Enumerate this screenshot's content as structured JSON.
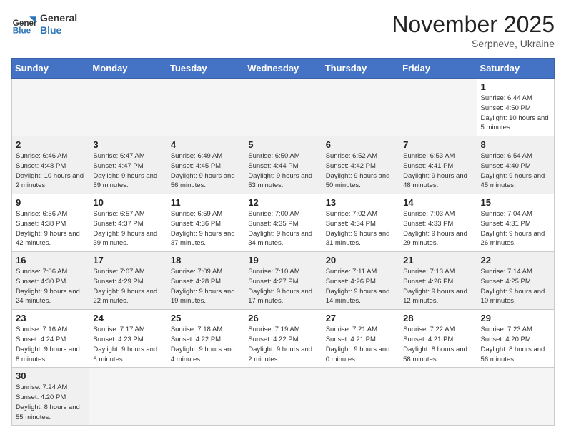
{
  "header": {
    "logo_general": "General",
    "logo_blue": "Blue",
    "month_title": "November 2025",
    "subtitle": "Serpneve, Ukraine"
  },
  "days_of_week": [
    "Sunday",
    "Monday",
    "Tuesday",
    "Wednesday",
    "Thursday",
    "Friday",
    "Saturday"
  ],
  "weeks": [
    [
      {
        "day": "",
        "info": ""
      },
      {
        "day": "",
        "info": ""
      },
      {
        "day": "",
        "info": ""
      },
      {
        "day": "",
        "info": ""
      },
      {
        "day": "",
        "info": ""
      },
      {
        "day": "",
        "info": ""
      },
      {
        "day": "1",
        "info": "Sunrise: 6:44 AM\nSunset: 4:50 PM\nDaylight: 10 hours and 5 minutes."
      }
    ],
    [
      {
        "day": "2",
        "info": "Sunrise: 6:46 AM\nSunset: 4:48 PM\nDaylight: 10 hours and 2 minutes."
      },
      {
        "day": "3",
        "info": "Sunrise: 6:47 AM\nSunset: 4:47 PM\nDaylight: 9 hours and 59 minutes."
      },
      {
        "day": "4",
        "info": "Sunrise: 6:49 AM\nSunset: 4:45 PM\nDaylight: 9 hours and 56 minutes."
      },
      {
        "day": "5",
        "info": "Sunrise: 6:50 AM\nSunset: 4:44 PM\nDaylight: 9 hours and 53 minutes."
      },
      {
        "day": "6",
        "info": "Sunrise: 6:52 AM\nSunset: 4:42 PM\nDaylight: 9 hours and 50 minutes."
      },
      {
        "day": "7",
        "info": "Sunrise: 6:53 AM\nSunset: 4:41 PM\nDaylight: 9 hours and 48 minutes."
      },
      {
        "day": "8",
        "info": "Sunrise: 6:54 AM\nSunset: 4:40 PM\nDaylight: 9 hours and 45 minutes."
      }
    ],
    [
      {
        "day": "9",
        "info": "Sunrise: 6:56 AM\nSunset: 4:38 PM\nDaylight: 9 hours and 42 minutes."
      },
      {
        "day": "10",
        "info": "Sunrise: 6:57 AM\nSunset: 4:37 PM\nDaylight: 9 hours and 39 minutes."
      },
      {
        "day": "11",
        "info": "Sunrise: 6:59 AM\nSunset: 4:36 PM\nDaylight: 9 hours and 37 minutes."
      },
      {
        "day": "12",
        "info": "Sunrise: 7:00 AM\nSunset: 4:35 PM\nDaylight: 9 hours and 34 minutes."
      },
      {
        "day": "13",
        "info": "Sunrise: 7:02 AM\nSunset: 4:34 PM\nDaylight: 9 hours and 31 minutes."
      },
      {
        "day": "14",
        "info": "Sunrise: 7:03 AM\nSunset: 4:33 PM\nDaylight: 9 hours and 29 minutes."
      },
      {
        "day": "15",
        "info": "Sunrise: 7:04 AM\nSunset: 4:31 PM\nDaylight: 9 hours and 26 minutes."
      }
    ],
    [
      {
        "day": "16",
        "info": "Sunrise: 7:06 AM\nSunset: 4:30 PM\nDaylight: 9 hours and 24 minutes."
      },
      {
        "day": "17",
        "info": "Sunrise: 7:07 AM\nSunset: 4:29 PM\nDaylight: 9 hours and 22 minutes."
      },
      {
        "day": "18",
        "info": "Sunrise: 7:09 AM\nSunset: 4:28 PM\nDaylight: 9 hours and 19 minutes."
      },
      {
        "day": "19",
        "info": "Sunrise: 7:10 AM\nSunset: 4:27 PM\nDaylight: 9 hours and 17 minutes."
      },
      {
        "day": "20",
        "info": "Sunrise: 7:11 AM\nSunset: 4:26 PM\nDaylight: 9 hours and 14 minutes."
      },
      {
        "day": "21",
        "info": "Sunrise: 7:13 AM\nSunset: 4:26 PM\nDaylight: 9 hours and 12 minutes."
      },
      {
        "day": "22",
        "info": "Sunrise: 7:14 AM\nSunset: 4:25 PM\nDaylight: 9 hours and 10 minutes."
      }
    ],
    [
      {
        "day": "23",
        "info": "Sunrise: 7:16 AM\nSunset: 4:24 PM\nDaylight: 9 hours and 8 minutes."
      },
      {
        "day": "24",
        "info": "Sunrise: 7:17 AM\nSunset: 4:23 PM\nDaylight: 9 hours and 6 minutes."
      },
      {
        "day": "25",
        "info": "Sunrise: 7:18 AM\nSunset: 4:22 PM\nDaylight: 9 hours and 4 minutes."
      },
      {
        "day": "26",
        "info": "Sunrise: 7:19 AM\nSunset: 4:22 PM\nDaylight: 9 hours and 2 minutes."
      },
      {
        "day": "27",
        "info": "Sunrise: 7:21 AM\nSunset: 4:21 PM\nDaylight: 9 hours and 0 minutes."
      },
      {
        "day": "28",
        "info": "Sunrise: 7:22 AM\nSunset: 4:21 PM\nDaylight: 8 hours and 58 minutes."
      },
      {
        "day": "29",
        "info": "Sunrise: 7:23 AM\nSunset: 4:20 PM\nDaylight: 8 hours and 56 minutes."
      }
    ],
    [
      {
        "day": "30",
        "info": "Sunrise: 7:24 AM\nSunset: 4:20 PM\nDaylight: 8 hours and 55 minutes."
      },
      {
        "day": "",
        "info": ""
      },
      {
        "day": "",
        "info": ""
      },
      {
        "day": "",
        "info": ""
      },
      {
        "day": "",
        "info": ""
      },
      {
        "day": "",
        "info": ""
      },
      {
        "day": "",
        "info": ""
      }
    ]
  ]
}
